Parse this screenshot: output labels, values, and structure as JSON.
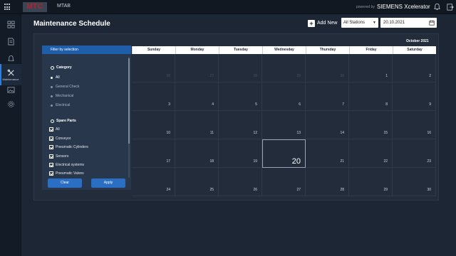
{
  "topbar": {
    "logo_text": "MTC",
    "app_name": "MTAB",
    "powered_by": "powered by",
    "brand": "SIEMENS Xcelerator",
    "icons": [
      "apps-grid-icon",
      "bell-icon",
      "logout-icon"
    ]
  },
  "sidenav": {
    "items": [
      {
        "icon": "dashboard-icon",
        "label": ""
      },
      {
        "icon": "document-icon",
        "label": ""
      },
      {
        "icon": "bell-icon",
        "label": ""
      },
      {
        "icon": "tools-icon",
        "label": "Maintenance",
        "active": true
      },
      {
        "icon": "image-icon",
        "label": ""
      },
      {
        "icon": "settings-gear-icon",
        "label": ""
      }
    ]
  },
  "header": {
    "title": "Maintenance Schedule",
    "add_new": "Add New",
    "station_select": "All Stations",
    "date_value": "20.10.2021"
  },
  "filter": {
    "heading": "Filter by selection",
    "category_title": "Category",
    "categories": [
      {
        "label": "All",
        "selected": true
      },
      {
        "label": "General Check",
        "selected": false
      },
      {
        "label": "Mechanical",
        "selected": false
      },
      {
        "label": "Electrical",
        "selected": false
      }
    ],
    "parts_title": "Spare Parts",
    "parts": [
      {
        "label": "All",
        "checked": true
      },
      {
        "label": "Conveyor",
        "checked": true
      },
      {
        "label": "Pneumatic Cylinders",
        "checked": true
      },
      {
        "label": "Sensors",
        "checked": true
      },
      {
        "label": "Electrical systems",
        "checked": true
      },
      {
        "label": "Pneumatic Valves",
        "checked": true
      }
    ],
    "clear_label": "Clear",
    "apply_label": "Apply"
  },
  "calendar": {
    "month": "October 2021",
    "weekdays": [
      "Sunday",
      "Monday",
      "Tuesday",
      "Wednesday",
      "Thursday",
      "Friday",
      "Saturday"
    ],
    "weeks": [
      [
        "26",
        "27",
        "28",
        "29",
        "30",
        "1",
        "2"
      ],
      [
        "3",
        "4",
        "5",
        "6",
        "7",
        "8",
        "9"
      ],
      [
        "10",
        "11",
        "12",
        "13",
        "14",
        "15",
        "16"
      ],
      [
        "17",
        "18",
        "19",
        "20",
        "21",
        "22",
        "23"
      ],
      [
        "24",
        "25",
        "26",
        "27",
        "28",
        "29",
        "30"
      ]
    ],
    "muted_days": [
      "26",
      "27",
      "28",
      "29",
      "30"
    ],
    "today": "20"
  },
  "colors": {
    "background": "#1d2634",
    "accent": "#2a6fc4",
    "header_blue": "#1f5ea8",
    "brand_red": "#b7212e"
  }
}
